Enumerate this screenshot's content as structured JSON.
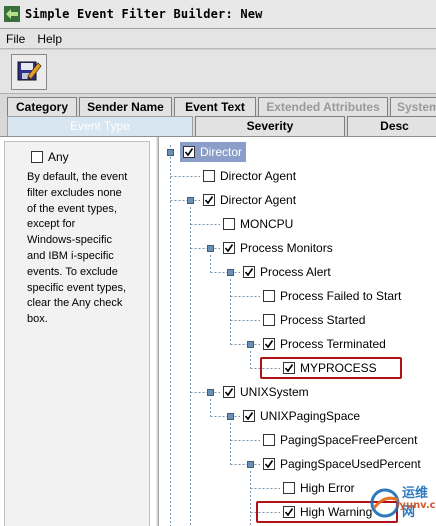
{
  "window": {
    "title": "Simple Event Filter Builder: New",
    "app_icon": "app-arrows-icon"
  },
  "menu": [
    {
      "label": "File"
    },
    {
      "label": "Help"
    }
  ],
  "toolbar": {
    "save_icon": "save-edit-icon"
  },
  "tabs": {
    "row1": [
      {
        "label": "Category",
        "enabled": true
      },
      {
        "label": "Sender Name",
        "enabled": true
      },
      {
        "label": "Event Text",
        "enabled": true
      },
      {
        "label": "Extended Attributes",
        "enabled": false
      },
      {
        "label": "System",
        "enabled": false
      }
    ],
    "row2": [
      {
        "label": "Event Type",
        "active": true
      },
      {
        "label": "Severity",
        "active": false
      },
      {
        "label": "Desc",
        "active": false
      }
    ]
  },
  "left_pane": {
    "any_label": "Any",
    "any_checked": false,
    "help_lines": [
      "By default, the event",
      "filter excludes none",
      "of the event types,",
      "except for",
      "Windows-specific",
      "and IBM i-specific",
      "events. To exclude",
      "specific event types,",
      "clear the Any check",
      "box."
    ]
  },
  "tree": {
    "nodes": [
      {
        "label": "Director",
        "checked": true,
        "selected": true
      },
      {
        "label": "Director Agent",
        "checked": false
      },
      {
        "label": "Director Agent",
        "checked": true
      },
      {
        "label": "MONCPU",
        "checked": false
      },
      {
        "label": "Process Monitors",
        "checked": true
      },
      {
        "label": "Process Alert",
        "checked": true
      },
      {
        "label": "Process Failed to Start",
        "checked": false
      },
      {
        "label": "Process Started",
        "checked": false
      },
      {
        "label": "Process Terminated",
        "checked": true
      },
      {
        "label": "MYPROCESS",
        "checked": true,
        "highlighted": true
      },
      {
        "label": "UNIXSystem",
        "checked": true
      },
      {
        "label": "UNIXPagingSpace",
        "checked": true
      },
      {
        "label": "PagingSpaceFreePercent",
        "checked": false
      },
      {
        "label": "PagingSpaceUsedPercent",
        "checked": true
      },
      {
        "label": "High Error",
        "checked": false
      },
      {
        "label": "High Warning",
        "checked": true,
        "highlighted": true
      }
    ]
  },
  "watermark": {
    "title": "运维网",
    "url": "iyunv.com"
  },
  "colors": {
    "highlight_box": "#b0121a",
    "selection": "#8a9ec9",
    "handle": "#6d8fb3"
  }
}
